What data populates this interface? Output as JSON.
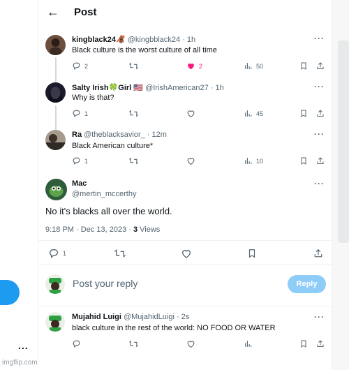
{
  "header": {
    "back_icon": "arrow-left-icon",
    "title": "Post"
  },
  "tweets": [
    {
      "name": "kingblack24",
      "emoji": "🦧",
      "handle": "@kingbblack24",
      "time": "· 1h",
      "text": "Black culture is the worst culture of all time",
      "replies": "2",
      "reposts": "",
      "likes": "2",
      "liked": true,
      "views": "50"
    },
    {
      "name": "Salty Irish",
      "emoji": "🍀",
      "name_suffix": "Girl",
      "flag": "🇺🇸",
      "handle": "@IrishAmerican27",
      "time": "· 1h",
      "text": "Why is that?",
      "replies": "1",
      "reposts": "",
      "likes": "",
      "views": "45"
    },
    {
      "name": "Ra",
      "handle": "@theblacksavior_",
      "time": "· 12m",
      "text": "Black American  culture*",
      "replies": "1",
      "reposts": "",
      "likes": "",
      "views": "10"
    }
  ],
  "main_post": {
    "name": "Mac",
    "handle": "@mertin_mccerthy",
    "text": "No it's blacks all over the world.",
    "time": "9:18 PM",
    "date": "Dec 13, 2023",
    "views_count": "3",
    "views_label": "Views",
    "replies": "1"
  },
  "reply_box": {
    "placeholder": "Post your reply",
    "button_label": "Reply"
  },
  "last_reply": {
    "name": "Mujahid Luigi",
    "handle": "@MujahidLuigi",
    "time": "· 2s",
    "text": "black culture in the rest of the world: NO FOOD OR WATER"
  },
  "sidebar": {
    "more_label": "..."
  },
  "watermark": "imgflip.com",
  "colors": {
    "accent": "#1d9bf0",
    "like": "#f91880",
    "muted": "#536471",
    "reply_button": "#8ecdf8"
  }
}
